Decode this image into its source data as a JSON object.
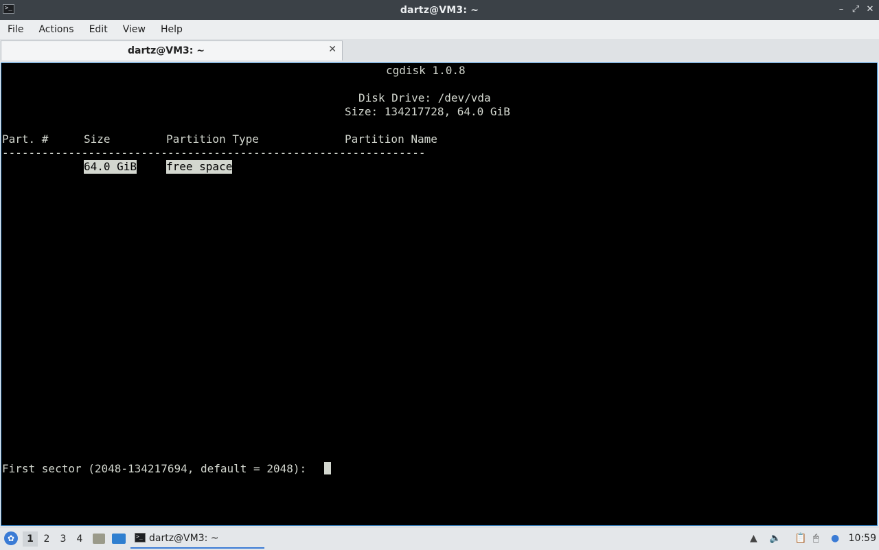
{
  "window": {
    "title": "dartz@VM3: ~"
  },
  "menu": [
    "File",
    "Actions",
    "Edit",
    "View",
    "Help"
  ],
  "tab": {
    "label": "dartz@VM3: ~",
    "close_icon": "close-icon"
  },
  "terminal": {
    "app_title": "cgdisk 1.0.8",
    "disk_drive": "Disk Drive: /dev/vda",
    "disk_size": "Size: 134217728, 64.0 GiB",
    "columns": {
      "part_num": "Part. #",
      "size": "Size",
      "partition_type": "Partition Type",
      "partition_name": "Partition Name"
    },
    "separator": "----------------------------------------------------------------",
    "rows": [
      {
        "size": "64.0 GiB",
        "type": "free space"
      }
    ],
    "prompt": "First sector (2048-134217694, default = 2048): "
  },
  "taskbar": {
    "workspaces": [
      "1",
      "2",
      "3",
      "4"
    ],
    "active_workspace": "1",
    "task_label": "dartz@VM3: ~",
    "clock": "10:59"
  }
}
